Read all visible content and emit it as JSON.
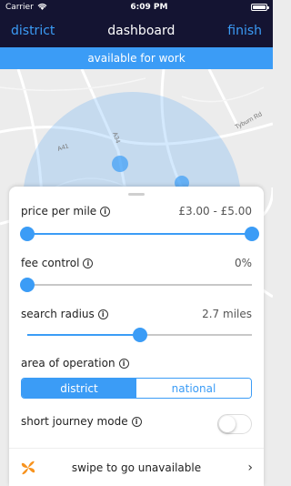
{
  "status_bar": {
    "carrier": "Carrier",
    "time": "6:09 PM",
    "icons": [
      "wifi-icon",
      "battery-icon"
    ]
  },
  "nav": {
    "left": "district",
    "title": "dashboard",
    "right": "finish"
  },
  "banner": "available for work",
  "map": {
    "labels": [
      "A41",
      "A34",
      "Tyburn Rd"
    ],
    "accent": "#3b9cf6"
  },
  "panel": {
    "price": {
      "label": "price per mile",
      "value": "£3.00 - £5.00",
      "range_fraction": [
        0.0,
        1.0
      ]
    },
    "fee": {
      "label": "fee control",
      "value": "0%",
      "fraction": 0.0
    },
    "radius": {
      "label": "search radius",
      "value": "2.7 miles",
      "fraction": 0.5
    },
    "area": {
      "label": "area of operation",
      "options": [
        "district",
        "national"
      ],
      "selected": "district"
    },
    "short_journey": {
      "label": "short journey mode",
      "enabled": false
    },
    "swipe": {
      "text": "swipe to go unavailable"
    }
  },
  "colors": {
    "nav_bg": "#141432",
    "accent": "#3b9cf6",
    "logo_orange": "#f7931e"
  }
}
